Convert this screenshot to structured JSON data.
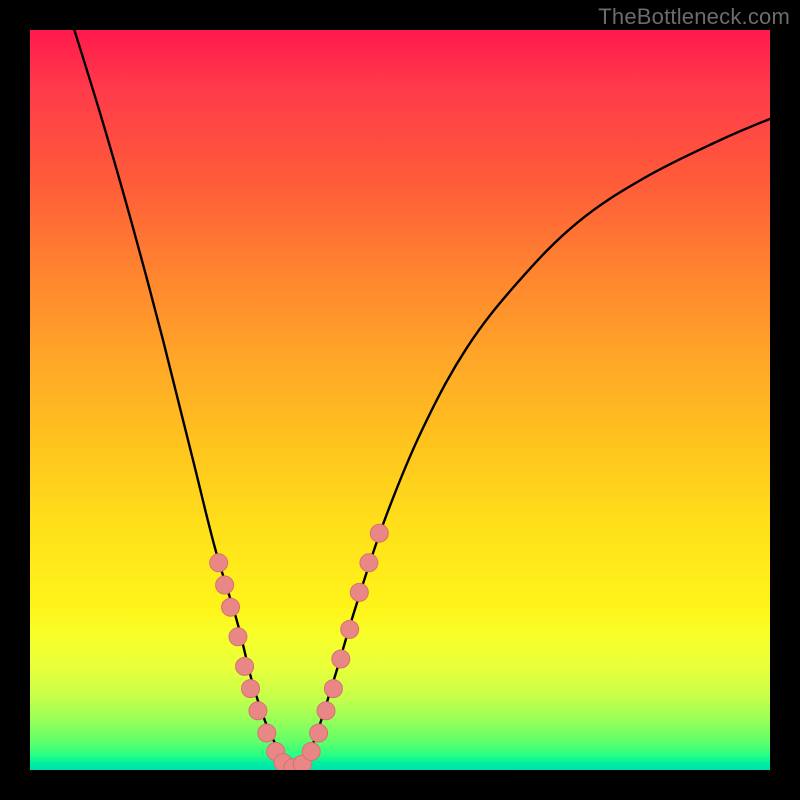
{
  "watermark": "TheBottleneck.com",
  "colors": {
    "frame": "#000000",
    "curve": "#000000",
    "marker_fill": "#e98787",
    "marker_stroke": "#d87070",
    "gradient_top": "#ff1a4d",
    "gradient_bottom": "#00e0b0"
  },
  "chart_data": {
    "type": "line",
    "title": "",
    "xlabel": "",
    "ylabel": "",
    "xlim": [
      0,
      100
    ],
    "ylim": [
      0,
      100
    ],
    "curve": {
      "comment": "Two-branch V curve. y expressed from top (100=top red, 0=bottom green). Approximate percent coordinates.",
      "left_branch": [
        {
          "x": 6,
          "y": 100
        },
        {
          "x": 10,
          "y": 87
        },
        {
          "x": 14,
          "y": 73
        },
        {
          "x": 18,
          "y": 58
        },
        {
          "x": 22,
          "y": 42
        },
        {
          "x": 25,
          "y": 30
        },
        {
          "x": 28,
          "y": 20
        },
        {
          "x": 30,
          "y": 12
        },
        {
          "x": 32,
          "y": 6
        },
        {
          "x": 34,
          "y": 2
        },
        {
          "x": 35.5,
          "y": 0
        }
      ],
      "right_branch": [
        {
          "x": 35.5,
          "y": 0
        },
        {
          "x": 38,
          "y": 3
        },
        {
          "x": 41,
          "y": 12
        },
        {
          "x": 44,
          "y": 22
        },
        {
          "x": 48,
          "y": 34
        },
        {
          "x": 53,
          "y": 46
        },
        {
          "x": 59,
          "y": 57
        },
        {
          "x": 66,
          "y": 66
        },
        {
          "x": 74,
          "y": 74
        },
        {
          "x": 83,
          "y": 80
        },
        {
          "x": 93,
          "y": 85
        },
        {
          "x": 100,
          "y": 88
        }
      ]
    },
    "markers": [
      {
        "x": 25.5,
        "y": 28
      },
      {
        "x": 26.3,
        "y": 25
      },
      {
        "x": 27.1,
        "y": 22
      },
      {
        "x": 28.1,
        "y": 18
      },
      {
        "x": 29.0,
        "y": 14
      },
      {
        "x": 29.8,
        "y": 11
      },
      {
        "x": 30.8,
        "y": 8
      },
      {
        "x": 32.0,
        "y": 5
      },
      {
        "x": 33.2,
        "y": 2.5
      },
      {
        "x": 34.2,
        "y": 1
      },
      {
        "x": 35.5,
        "y": 0.3
      },
      {
        "x": 36.8,
        "y": 0.8
      },
      {
        "x": 38.0,
        "y": 2.5
      },
      {
        "x": 39.0,
        "y": 5
      },
      {
        "x": 40.0,
        "y": 8
      },
      {
        "x": 41.0,
        "y": 11
      },
      {
        "x": 42.0,
        "y": 15
      },
      {
        "x": 43.2,
        "y": 19
      },
      {
        "x": 44.5,
        "y": 24
      },
      {
        "x": 45.8,
        "y": 28
      },
      {
        "x": 47.2,
        "y": 32
      }
    ]
  }
}
